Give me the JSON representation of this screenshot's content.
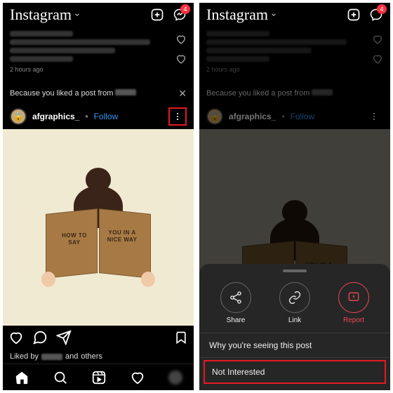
{
  "app": {
    "name": "Instagram",
    "badge_count": "4"
  },
  "prev_post": {
    "timestamp": "2 hours ago"
  },
  "because_row": {
    "text": "Because you liked a post from"
  },
  "post": {
    "username": "afgraphics_",
    "follow_label": "Follow",
    "book_left": "HOW TO\nSAY",
    "book_right": "YOU IN\nA\nNICE WAY"
  },
  "liked_by": {
    "prefix": "Liked by",
    "suffix": "and",
    "others": "others"
  },
  "sheet": {
    "share": "Share",
    "link": "Link",
    "report": "Report",
    "why": "Why you're seeing this post",
    "not_interested": "Not Interested"
  }
}
